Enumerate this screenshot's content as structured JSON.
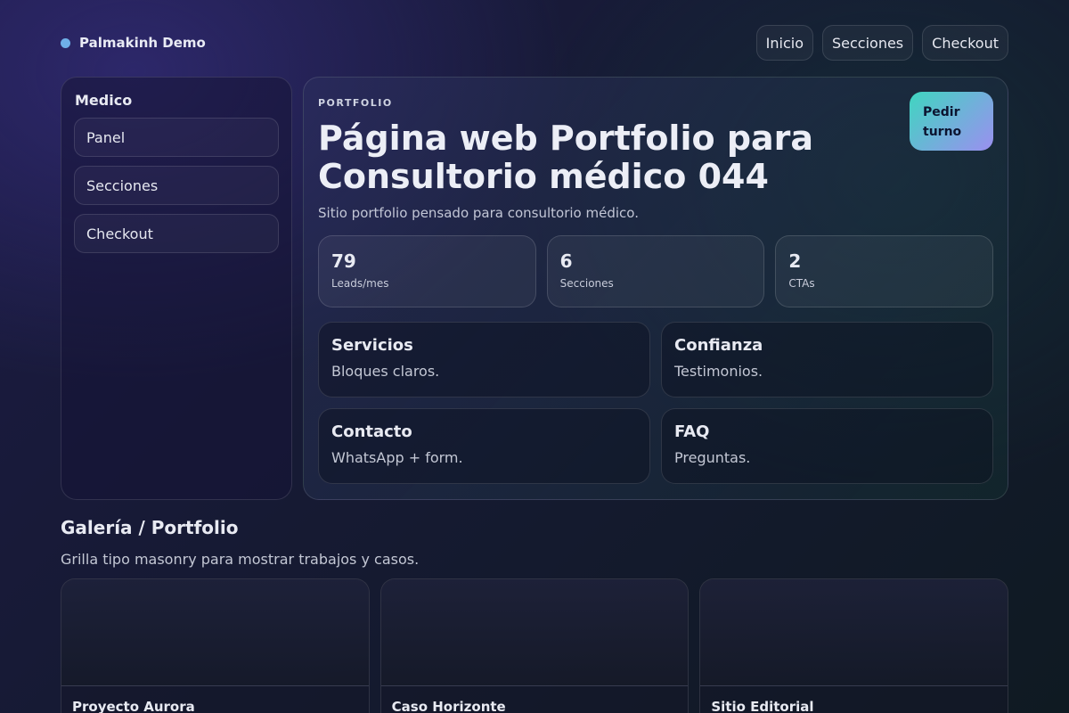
{
  "brand": {
    "name": "Palmakinh Demo"
  },
  "nav": [
    "Inicio",
    "Secciones",
    "Checkout"
  ],
  "sidebar": {
    "title": "Medico",
    "items": [
      "Panel",
      "Secciones",
      "Checkout"
    ]
  },
  "hero": {
    "eyebrow": "PORTFOLIO",
    "title": "Página web Portfolio para Consultorio médico 044",
    "subtitle": "Sitio portfolio pensado para consultorio médico.",
    "cta_label": "Pedir turno"
  },
  "stats": [
    {
      "value": "79",
      "label": "Leads/mes"
    },
    {
      "value": "6",
      "label": "Secciones"
    },
    {
      "value": "2",
      "label": "CTAs"
    }
  ],
  "features": [
    {
      "title": "Servicios",
      "desc": "Bloques claros."
    },
    {
      "title": "Confianza",
      "desc": "Testimonios."
    },
    {
      "title": "Contacto",
      "desc": "WhatsApp + form."
    },
    {
      "title": "FAQ",
      "desc": "Preguntas."
    }
  ],
  "gallery": {
    "title": "Galería / Portfolio",
    "subtitle": "Grilla tipo masonry para mostrar trabajos y casos.",
    "items": [
      "Proyecto Aurora",
      "Caso Horizonte",
      "Sitio Editorial"
    ]
  },
  "colors": {
    "accent_start": "#3fd6c0",
    "accent_end": "#9b8ff0",
    "brand_dot": "#6fb0e8"
  }
}
